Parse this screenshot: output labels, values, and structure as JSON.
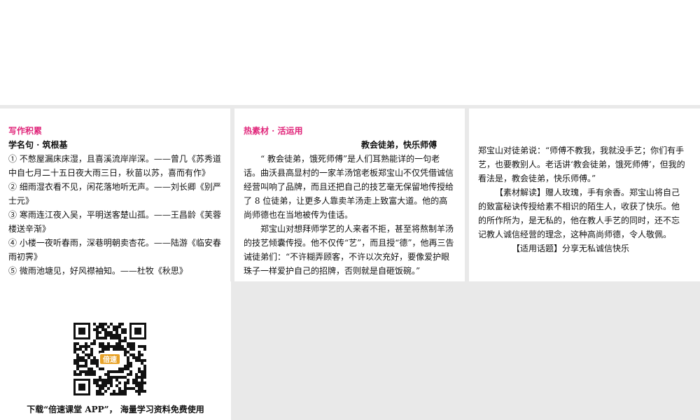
{
  "panel1": {
    "section_tag": "写作积累",
    "heading": "学名句 · 筑根基",
    "lines": [
      "① 不憋屋漏床床湿，且喜溪流岸岸深。——曾几《苏秀道中自七月二十五日夜大雨三日，秋苗以苏，喜而有作》",
      "② 细雨湿衣看不见，闲花落地听无声。——刘长卿《别严士元》",
      "③ 寒雨连江夜入吴，平明送客楚山孤。——王昌龄《芙蓉楼送辛渐》",
      "④ 小楼一夜听春雨，深巷明朝卖杏花。——陆游《临安春雨初霁》",
      "⑤ 微雨池塘见，好风襟袖知。——杜牧《秋思》"
    ]
  },
  "panel2": {
    "section_tag": "热素材 · 活运用",
    "title": "教会徒弟，快乐师傅",
    "para1": "“ 教会徒弟，饿死师傅”是人们耳熟能详的一句老话。曲沃县高显村的一家羊汤馆老板郑宝山不仅凭借诚信经营叫响了品牌，而且还把自己的技艺毫无保留地传授给了 8 位徒弟，让更多人靠卖羊汤走上致富大道。他的高尚师德也在当地被传为佳话。",
    "para2": "郑宝山对想拜师学艺的人来者不拒，甚至将熬制羊汤的技艺倾囊传授。他不仅传“艺”，而且授“德”，他再三告诫徒弟们：“不许糊弄顾客，不许以次充好，要像爱护眼珠子一样爱护自己的招牌，否则就是自砸饭碗。”"
  },
  "panel3": {
    "para1": "郑宝山对徒弟说：“师傅不教我，我就没手艺；你们有手艺，也要教别人。老话讲‘教会徒弟，饿死师傅’，但我的看法是，教会徒弟，快乐师傅。”",
    "para2": "【素材解读】赠人玫瑰，手有余香。郑宝山将自己的致富秘诀传授给素不相识的陌生人，收获了快乐。他的所作所为，是无私的，他在教人手艺的同时，还不忘记教人诚信经营的理念，这种高尚师德，令人敬佩。",
    "para3": "【适用话题】分享无私诚信快乐"
  },
  "promo": {
    "logo_text": "倍速",
    "caption": "下载“倍速课堂 APP”， 海量学习资料免费使用"
  },
  "colors": {
    "accent": "#e0267a",
    "divider": "#e9e9e9",
    "logo_bg": "#e8a32a"
  }
}
